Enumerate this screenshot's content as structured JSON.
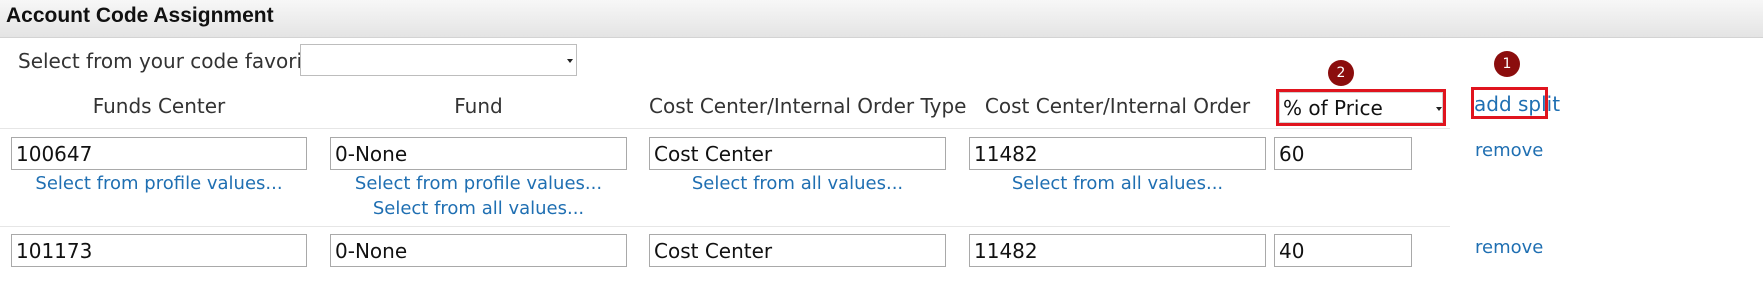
{
  "section": {
    "title": "Account Code Assignment"
  },
  "favorites": {
    "label": "Select from your code favorites",
    "value": ""
  },
  "columns": {
    "funds_center": "Funds Center",
    "fund": "Fund",
    "cc_type": "Cost Center/Internal Order Type",
    "cc_order": "Cost Center/Internal Order",
    "split_mode": "% of Price"
  },
  "callouts": {
    "one": "1",
    "two": "2"
  },
  "add_split": "add split",
  "rows": [
    {
      "funds_center": "100647",
      "fund": "0-None",
      "cc_type": "Cost Center",
      "cc_order": "11482",
      "percent": "60",
      "remove": "remove",
      "links": {
        "funds_center": "Select from profile values...",
        "fund_profile": "Select from profile values...",
        "fund_all": "Select from all values...",
        "cc_type": "Select from all values...",
        "cc_order": "Select from all values..."
      }
    },
    {
      "funds_center": "101173",
      "fund": "0-None",
      "cc_type": "Cost Center",
      "cc_order": "11482",
      "percent": "40",
      "remove": "remove"
    }
  ]
}
